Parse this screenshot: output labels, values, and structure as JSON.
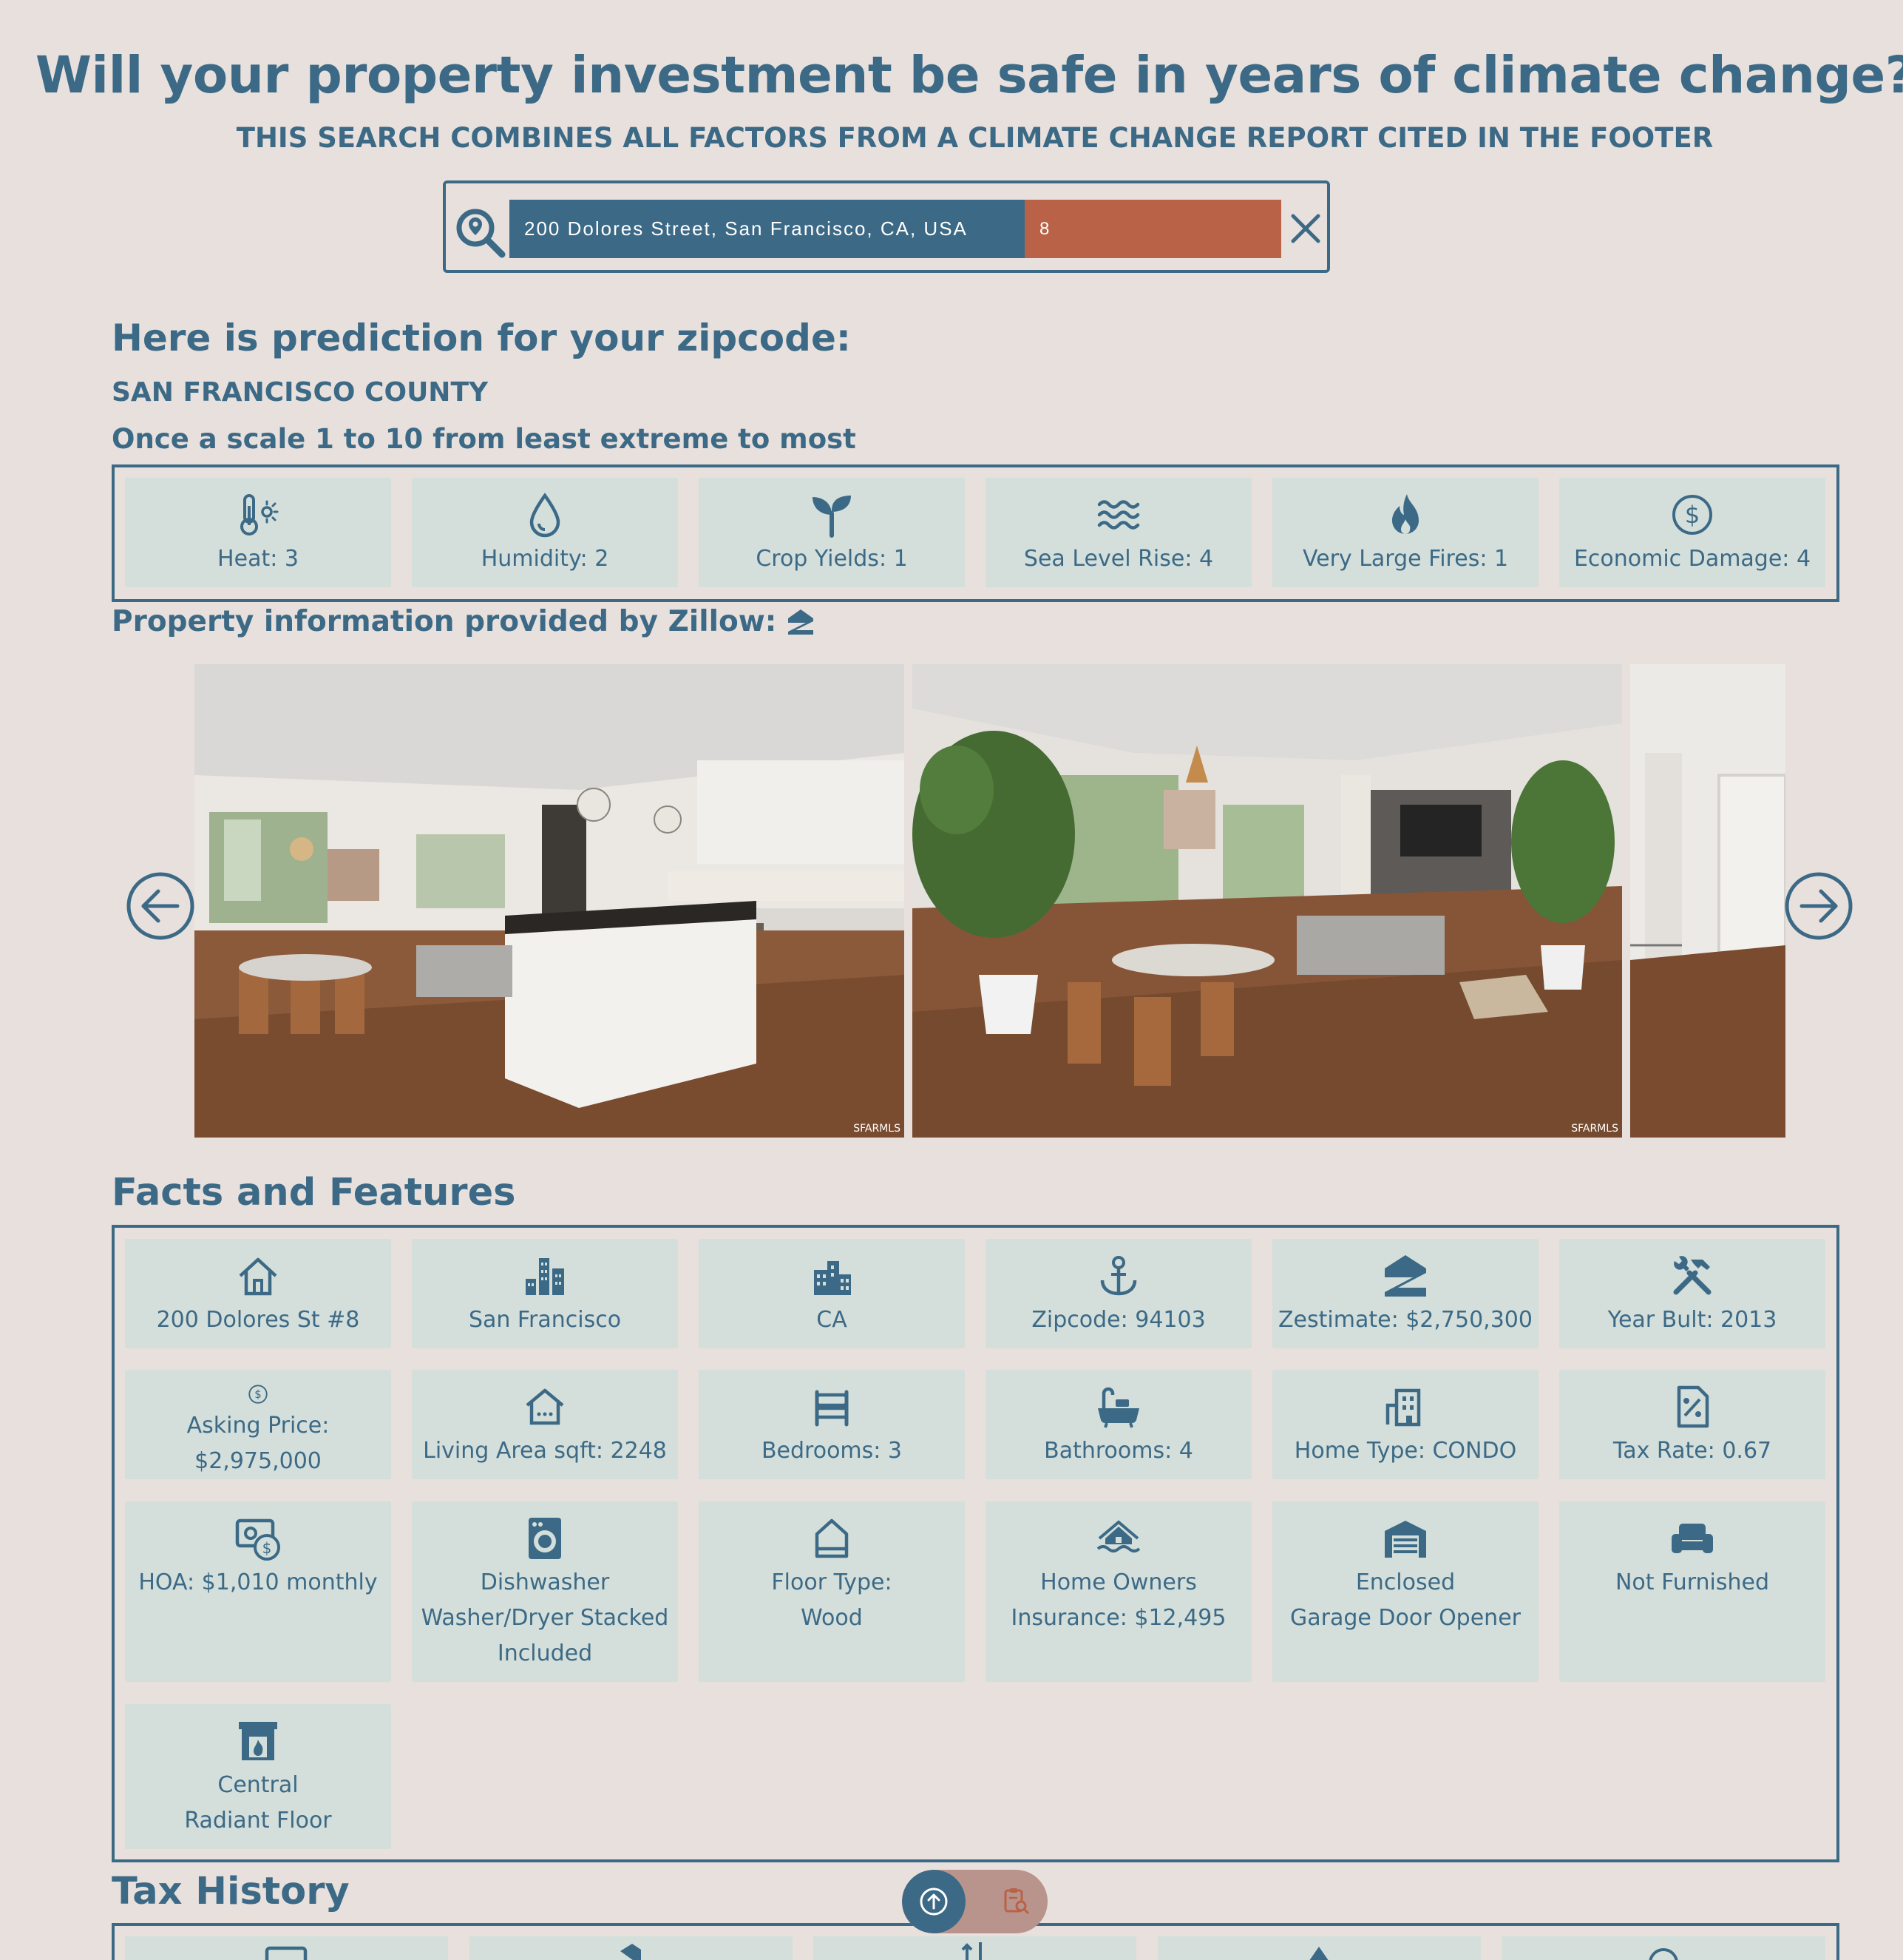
{
  "header": {
    "title": "Will your property investment be safe in years of climate change?",
    "subtitle": "THIS SEARCH COMBINES ALL FACTORS FROM A CLIMATE CHANGE REPORT CITED IN THE FOOTER"
  },
  "search": {
    "address": "200 Dolores Street, San Francisco, CA, USA",
    "score": "8"
  },
  "prediction": {
    "heading": "Here is prediction for your zipcode:",
    "county": "SAN FRANCISCO COUNTY",
    "scale_note": "Once a scale 1 to 10 from least extreme to most",
    "factors": [
      {
        "icon": "thermometer-sun-icon",
        "label": "Heat: 3"
      },
      {
        "icon": "droplet-icon",
        "label": "Humidity: 2"
      },
      {
        "icon": "sprout-icon",
        "label": "Crop Yields: 1"
      },
      {
        "icon": "waves-icon",
        "label": "Sea Level Rise: 4"
      },
      {
        "icon": "flame-icon",
        "label": "Very Large Fires: 1"
      },
      {
        "icon": "dollar-circle-icon",
        "label": "Economic Damage: 4"
      }
    ]
  },
  "zillow": {
    "heading": "Property information provided by Zillow:",
    "icon": "zillow-icon",
    "photos": [
      {
        "name": "kitchen-photo",
        "watermark": "SFARMLS"
      },
      {
        "name": "living-room-photo",
        "watermark": "SFARMLS"
      },
      {
        "name": "hallway-photo",
        "watermark": ""
      }
    ]
  },
  "facts": {
    "heading": "Facts and Features",
    "items": [
      {
        "icon": "house-icon",
        "lines": [
          "200 Dolores St #8"
        ]
      },
      {
        "icon": "city-icon",
        "lines": [
          "San Francisco"
        ]
      },
      {
        "icon": "buildings-icon",
        "lines": [
          "CA"
        ]
      },
      {
        "icon": "anchor-icon",
        "lines": [
          "Zipcode: 94103"
        ]
      },
      {
        "icon": "zillow-icon",
        "lines": [
          "Zestimate: $2,750,300"
        ]
      },
      {
        "icon": "tools-icon",
        "lines": [
          "Year Bult: 2013"
        ]
      },
      {
        "icon": "dollar-circle-icon",
        "lines": [
          "Asking Price: $2,975,000"
        ]
      },
      {
        "icon": "home-outline-icon",
        "lines": [
          "Living Area sqft: 2248"
        ]
      },
      {
        "icon": "bed-icon",
        "lines": [
          "Bedrooms: 3"
        ]
      },
      {
        "icon": "bathtub-icon",
        "lines": [
          "Bathrooms: 4"
        ]
      },
      {
        "icon": "building-type-icon",
        "lines": [
          "Home Type: CONDO"
        ]
      },
      {
        "icon": "tax-percent-icon",
        "lines": [
          "Tax Rate: 0.67"
        ]
      },
      {
        "icon": "money-bill-icon",
        "lines": [
          "HOA: $1,010 monthly"
        ]
      },
      {
        "icon": "washing-machine-icon",
        "lines": [
          "Dishwasher",
          "Washer/Dryer Stacked",
          "Included"
        ]
      },
      {
        "icon": "floor-home-icon",
        "lines": [
          "Floor Type:",
          "Wood"
        ]
      },
      {
        "icon": "house-flood-icon",
        "lines": [
          "Home Owners",
          "Insurance: $12,495"
        ]
      },
      {
        "icon": "garage-icon",
        "lines": [
          "Enclosed",
          "Garage Door Opener"
        ]
      },
      {
        "icon": "couch-icon",
        "lines": [
          "Not Furnished"
        ]
      },
      {
        "icon": "fireplace-icon",
        "lines": [
          "Central",
          "Radiant Floor"
        ]
      }
    ]
  },
  "tax_history": {
    "heading": "Tax History"
  },
  "colors": {
    "primary": "#3c6a86",
    "accent": "#b96248",
    "background": "#e8e0dc",
    "tile": "#d4dfdb"
  }
}
